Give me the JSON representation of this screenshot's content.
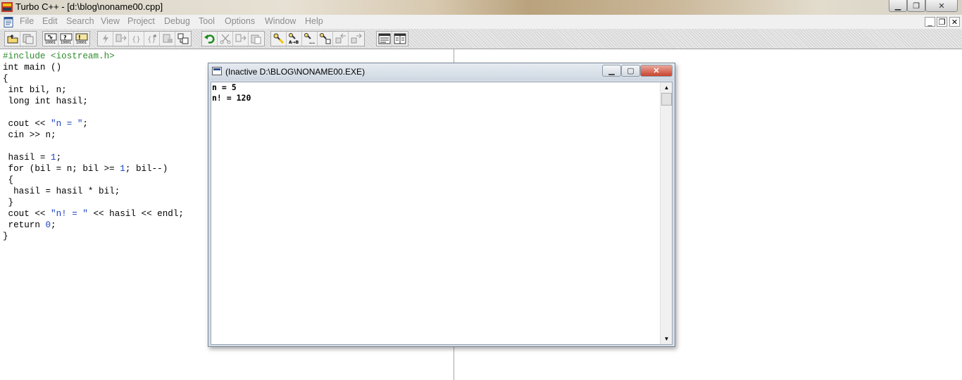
{
  "window": {
    "title": "Turbo C++ - [d:\\blog\\noname00.cpp]"
  },
  "menu": {
    "items": [
      {
        "label": "File"
      },
      {
        "label": "Edit"
      },
      {
        "label": "Search"
      },
      {
        "label": "View"
      },
      {
        "label": "Project"
      },
      {
        "label": "Debug"
      },
      {
        "label": "Tool"
      },
      {
        "label": "Options"
      },
      {
        "label": "Window"
      },
      {
        "label": "Help"
      }
    ]
  },
  "code": [
    "#include <iostream.h>",
    "int main ()",
    "{",
    " int bil, n;",
    " long int hasil;",
    "",
    " cout << \"n = \";",
    " cin >> n;",
    "",
    " hasil = 1;",
    " for (bil = n; bil >= 1; bil--)",
    " {",
    "  hasil = hasil * bil;",
    " }",
    " cout << \"n! = \" << hasil << endl;",
    " return 0;",
    "}"
  ],
  "console": {
    "title": "(Inactive D:\\BLOG\\NONAME00.EXE)",
    "output": [
      "n = 5",
      "n! = 120"
    ]
  },
  "toolbar": {
    "icons": [
      "open-icon",
      "save-icon",
      "step-over-icon",
      "trace-into-icon",
      "run-to-cursor-icon",
      "make-icon",
      "compile-icon",
      "build-icon",
      "toggle-breakpoint-icon",
      "evaluate-icon",
      "inspect-icon",
      "add-watch-icon",
      "undo-icon",
      "cut-icon",
      "copy-icon",
      "paste-icon",
      "search-icon",
      "replace-icon",
      "search-again-icon",
      "browse-symbol-icon",
      "previous-message-icon",
      "next-message-icon",
      "tile-icon",
      "cascade-icon"
    ]
  },
  "colors": {
    "preprocessor": "#2e8b2e",
    "string": "#1a3fbf",
    "menu_disabled": "#8c8c8c"
  }
}
